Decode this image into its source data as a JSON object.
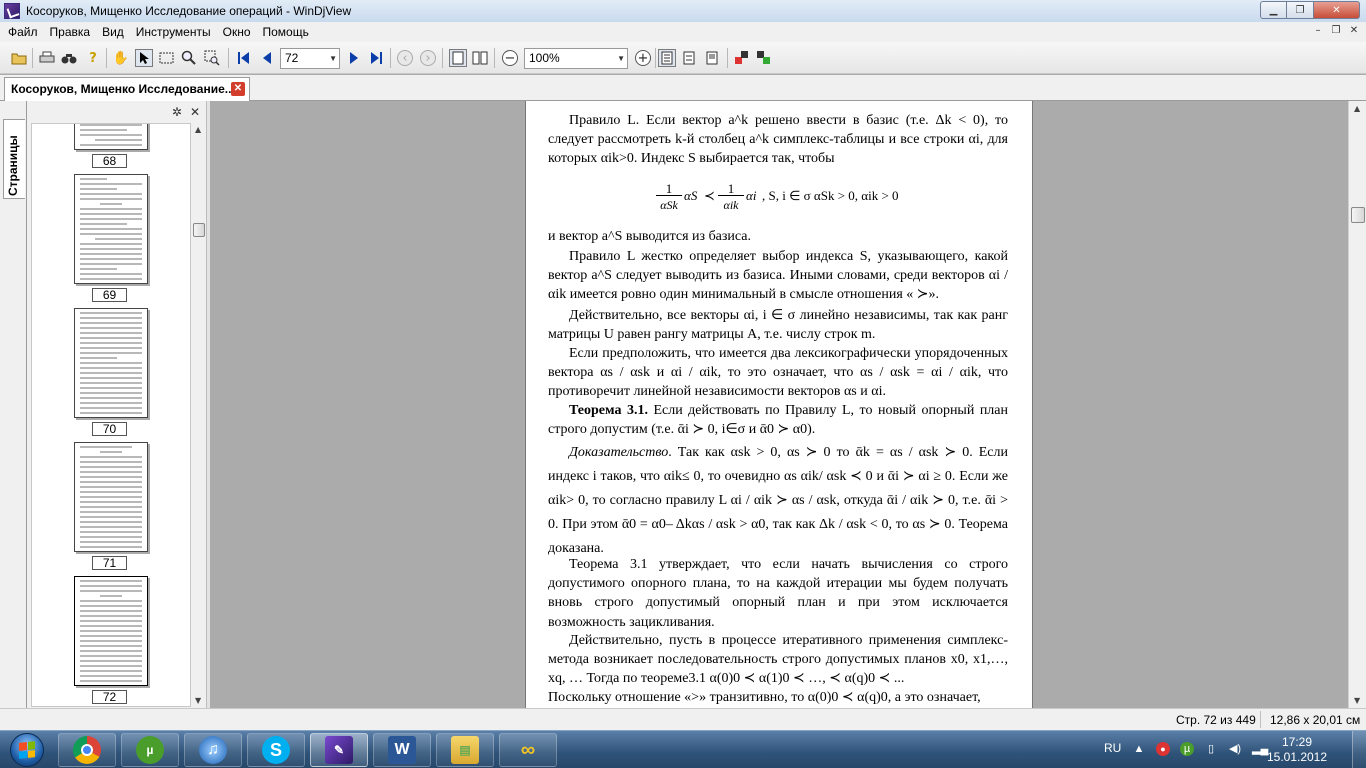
{
  "window": {
    "title": "Косоруков, Мищенко Исследование операций - WinDjView",
    "controls": {
      "minimize": "▁",
      "maximize": "❐",
      "close": "✕"
    }
  },
  "menu": {
    "items": [
      "Файл",
      "Правка",
      "Вид",
      "Инструменты",
      "Окно",
      "Помощь"
    ]
  },
  "toolbar": {
    "page_number": "72",
    "zoom": "100%",
    "icons": [
      "open-icon",
      "print-icon",
      "find-icon",
      "help-icon",
      "hand-icon",
      "select-icon",
      "marquee-icon",
      "zoom-icon",
      "zoom-rect-icon",
      "first-page-icon",
      "prev-page-icon",
      "next-page-icon",
      "last-page-icon",
      "back-icon",
      "forward-icon",
      "single-page-icon",
      "two-page-icon",
      "zoom-out-icon",
      "zoom-in-icon",
      "continuous-icon",
      "facing-icon",
      "book-icon",
      "rotate-left-icon",
      "rotate-right-icon"
    ]
  },
  "tab": {
    "label": "Косоруков, Мищенко Исследование..."
  },
  "sidebar": {
    "tab_label": "Страницы",
    "thumbnails": [
      {
        "label": "68"
      },
      {
        "label": "69"
      },
      {
        "label": "70"
      },
      {
        "label": "71"
      },
      {
        "label": "72"
      }
    ]
  },
  "document": {
    "paragraphs": [
      "Правило L. Если вектор a^k решено ввести в базис (т.е. Δk < 0), то следует рассмотреть k-й столбец a^k симплекс-таблицы и все строки αi, для которых αik>0. Индекс S выбирается так, чтобы",
      "и вектор a^S выводится из базиса.",
      "Правило L жестко определяет выбор индекса S, указывающего, какой вектор a^S следует выводить из базиса. Иными словами, среди векторов αi / αik имеется ровно один минимальный в смысле отношения « ≻».",
      "Действительно, все векторы αi, i ∈ σ линейно независимы, так как ранг матрицы U равен рангу матрицы A, т.е. числу строк m.",
      "Если предположить, что имеется два лексикографически упорядоченных вектора αs / αsk и αi / αik, то это означает, что αs / αsk = αi / αik, что противоречит линейной независимости векторов αs и αi."
    ],
    "theorem_title": "Теорема 3.1.",
    "theorem_text": "Если действовать по Правилу L, то новый опорный план строго допустим (т.е. ᾱi ≻ 0, i∈σ и ᾱ0 ≻ α0).",
    "proof_title": "Доказательство",
    "proof_text": ". Так как αsk > 0, αs ≻ 0 то ᾱk = αs / αsk ≻ 0. Если индекс i таков, что αik≤ 0, то очевидно αs αik/ αsk ≺ 0 и ᾱi ≻ αi ≥ 0. Если же αik> 0, то согласно правилу L αi / αik ≻ αs / αsk, откуда ᾱi / αik ≻ 0, т.е. ᾱi > 0. При этом ᾱ0 = α0– Δkαs / αsk > α0, так как Δk / αsk < 0, то αs ≻ 0. Теорема доказана.",
    "after_paragraphs": [
      "Теорема 3.1 утверждает, что если начать вычисления со строго допустимого опорного плана, то на каждой итерации мы будем получать вновь строго допустимый опорный план и при этом исключается возможность зацикливания.",
      "Действительно, пусть в процессе итеративного применения симплекс-метода возникает последовательность строго допустимых планов x0, x1,…, xq, … Тогда по теореме3.1 α(0)0 ≺ α(1)0 ≺ …, ≺ α(q)0 ≺ ...",
      "Поскольку отношение «>» транзитивно, то α(0)0 ≺ α(q)0, а это означает,"
    ],
    "formula": {
      "one": "1",
      "den_s": "αSk",
      "den_i": "αik",
      "alpha_s": "αS",
      "prec": "≺",
      "alpha_i": "αi",
      "condition": ", S, i ∈ σ αSk > 0, αik > 0"
    }
  },
  "statusbar": {
    "page_info": "Стр. 72 из 449",
    "size_info": "12,86 x 20,01 см"
  },
  "taskbar": {
    "apps": [
      "chrome-icon",
      "utorrent-icon",
      "itunes-icon",
      "skype-icon",
      "windjview-icon",
      "word-icon",
      "explorer-icon",
      "link-icon"
    ],
    "tray": {
      "language": "RU",
      "time": "17:29",
      "date": "15.01.2012"
    }
  }
}
